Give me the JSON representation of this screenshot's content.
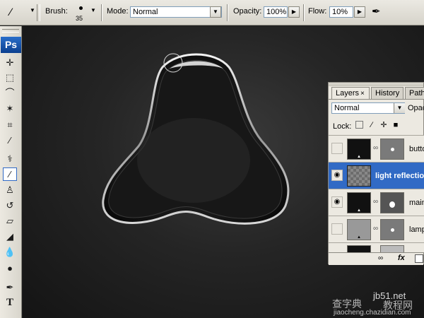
{
  "options": {
    "brush_label": "Brush:",
    "brush_size": "35",
    "mode_label": "Mode:",
    "mode_value": "Normal",
    "opacity_label": "Opacity:",
    "opacity_value": "100%",
    "flow_label": "Flow:",
    "flow_value": "10%"
  },
  "toolbox": {
    "logo": "Ps",
    "text_tool": "T"
  },
  "layers_panel": {
    "tabs": [
      {
        "label": "Layers",
        "close": "×"
      },
      {
        "label": "History"
      },
      {
        "label": "Path"
      }
    ],
    "blend_mode": "Normal",
    "opacity_label": "Opac",
    "lock_label": "Lock:",
    "layers": [
      {
        "name": "butto"
      },
      {
        "name": "light reflection"
      },
      {
        "name": "main"
      },
      {
        "name": "lamp"
      }
    ]
  },
  "watermark": {
    "site": "jb51.net",
    "line1": "查字典",
    "line2": "教程网",
    "url": "jiaocheng.chazidian.com"
  }
}
